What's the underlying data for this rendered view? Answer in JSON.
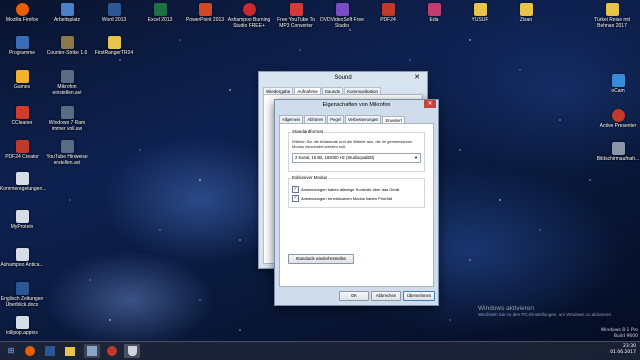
{
  "desktop": {
    "icons": [
      {
        "label": "Mozilla Firefox",
        "color": "#e66000"
      },
      {
        "label": "Arbeitsplatz",
        "color": "#4a80c8"
      },
      {
        "label": "Word 2013",
        "color": "#2b5797"
      },
      {
        "label": "Excel 2013",
        "color": "#1e7145"
      },
      {
        "label": "PowerPoint 2013",
        "color": "#d24726"
      },
      {
        "label": "Ashampoo Burning Studio FREE+",
        "color": "#c72b2b"
      },
      {
        "label": "Free YouTube To MP3 Converter",
        "color": "#d43a3a"
      },
      {
        "label": "DVDVideoSoft Free Studio",
        "color": "#7a4bc2"
      },
      {
        "label": "PDF24",
        "color": "#c0392b"
      },
      {
        "label": "Eda",
        "color": "#c23b6e"
      },
      {
        "label": "YUSUF",
        "color": "#e8c44a"
      },
      {
        "label": "Zisan",
        "color": "#e8c44a"
      },
      {
        "label": "Türkei Reise mit Behnan 2017",
        "color": "#e8c44a"
      },
      {
        "label": "Programme",
        "color": "#3a6db5"
      },
      {
        "label": "Counter-Strike 1.6",
        "color": "#8a7a4a"
      },
      {
        "label": "FirstRangerTR24",
        "color": "#e8c44a"
      },
      {
        "label": "Games",
        "color": "#f1b32b"
      },
      {
        "label": "Mikrofon einstellen.avi",
        "color": "#5a6b84"
      },
      {
        "label": "oCam",
        "color": "#3a8ad8"
      },
      {
        "label": "CCleaner",
        "color": "#d13c2b"
      },
      {
        "label": "Windows 7 Ram immer voll.avi",
        "color": "#5a6b84"
      },
      {
        "label": "Active Presenter",
        "color": "#c0392b"
      },
      {
        "label": "PDF24 Creator",
        "color": "#c0392b"
      },
      {
        "label": "YouTube Hinweise erstellen.avi",
        "color": "#5a6b84"
      },
      {
        "label": "Bildschirmaufnah...",
        "color": "#8a96a8"
      },
      {
        "label": "Kommeregelungen...",
        "color": "#d6dde6"
      },
      {
        "label": "MyProtein",
        "color": "#d6dde6"
      },
      {
        "label": "Ashampoo Antica...",
        "color": "#d6dde6"
      },
      {
        "label": "Englisch Zeitungen Überblick.docx",
        "color": "#2b5797"
      },
      {
        "label": "lollipop.appios",
        "color": "#d6dde6"
      }
    ]
  },
  "sound_window": {
    "title": "Sound",
    "close_glyph": "✕",
    "tabs": [
      "Wiedergabe",
      "Aufnahme",
      "Sounds",
      "Kommunikation"
    ],
    "active_tab": 1
  },
  "dialog": {
    "title": "Eigenschaften von Mikrofon",
    "close_glyph": "✕",
    "tabs": [
      "Allgemein",
      "Abhören",
      "Pegel",
      "Verbesserungen",
      "Erweitert"
    ],
    "active_tab": 4,
    "standard_format": {
      "title": "Standardformat",
      "description": "Wählen Sie die Abtastrate und die Bittiefe aus, die im gemeinsamen Modus verwendet werden soll.",
      "selected": "2 Kanal, 16 Bit, 192000 Hz (Studioqualität)"
    },
    "exclusive": {
      "title": "Exklusiver Modus",
      "option1": "Anwendungen haben alleinige Kontrolle über das Gerät",
      "option1_checked": true,
      "option2": "Anwendungen im exklusiven Modus haben Priorität",
      "option2_checked": true
    },
    "restore_defaults": "Standards wiederherstellen",
    "ok": "OK",
    "cancel": "Abbrechen",
    "apply": "Übernehmen"
  },
  "activation": {
    "line1": "Windows aktivieren",
    "line2": "Wechseln Sie zu den PC-Einstellungen, um Windows zu aktivieren."
  },
  "watermark": {
    "line1": "Windows 8.1 Pro",
    "line2": "Build 9600"
  },
  "taskbar": {
    "time": "23:30",
    "date": "01.06.2017"
  }
}
